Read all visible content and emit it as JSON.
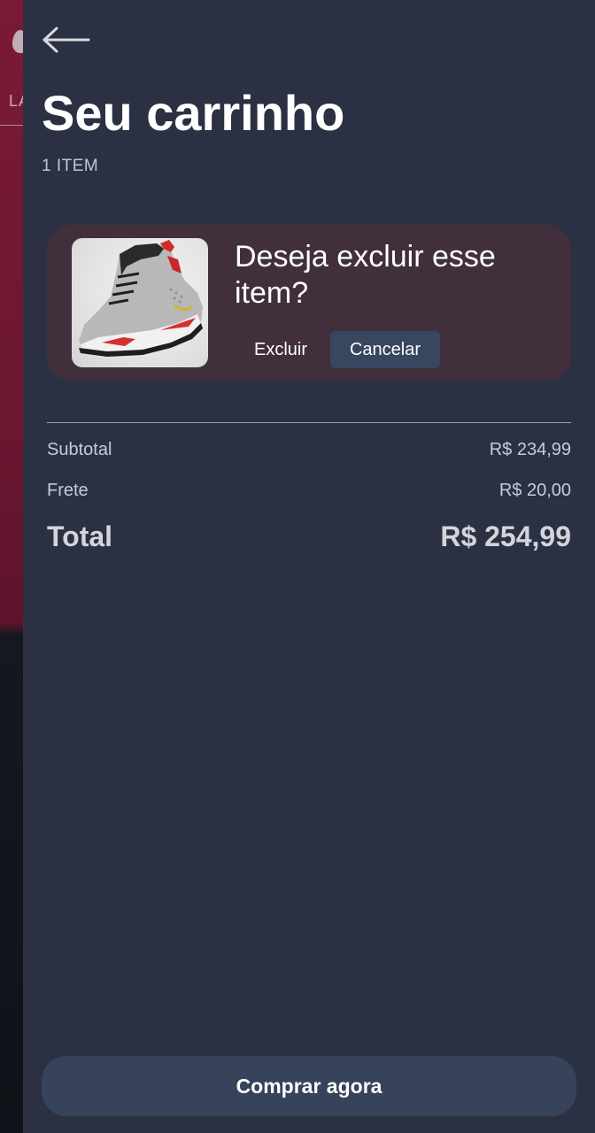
{
  "background_page": {
    "nav_label": "LA"
  },
  "cart": {
    "title": "Seu carrinho",
    "item_count": "1 ITEM",
    "item": {
      "image": "sneaker-photo",
      "confirm_question": "Deseja excluir esse item?",
      "delete_label": "Excluir",
      "cancel_label": "Cancelar"
    },
    "summary": {
      "subtotal_label": "Subtotal",
      "subtotal_value": "R$ 234,99",
      "shipping_label": "Frete",
      "shipping_value": "R$ 20,00",
      "total_label": "Total",
      "total_value": "R$ 254,99"
    },
    "checkout_label": "Comprar agora"
  },
  "icons": {
    "back": "arrow-left-icon",
    "logo": "drop-logo-icon"
  },
  "colors": {
    "drawer_bg": "#2b3142",
    "item_card_bg": "#41303c",
    "button_bg": "#37435a",
    "background_accent": "#7a1a35"
  }
}
